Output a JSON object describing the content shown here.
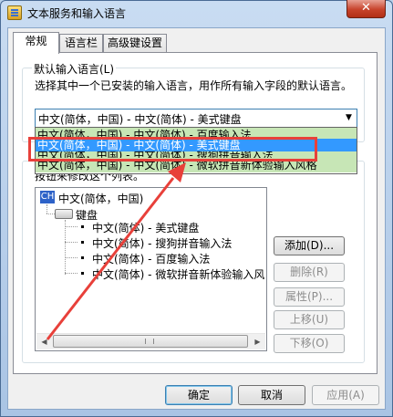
{
  "window": {
    "title": "文本服务和输入语言",
    "close_label": "✕"
  },
  "tabs": [
    {
      "label": "常规"
    },
    {
      "label": "语言栏"
    },
    {
      "label": "高级键设置"
    }
  ],
  "default_group": {
    "label": "默认输入语言(L)",
    "description": "选择其中一个已安装的输入语言，用作所有输入字段的默认语言。",
    "combo_value": "中文(简体，中国) - 中文(简体) - 美式键盘"
  },
  "dropdown_options": [
    {
      "label": "中文(简体，中国) - 中文(简体) - 百度输入法"
    },
    {
      "label": "中文(简体，中国) - 中文(简体) - 美式键盘"
    },
    {
      "label": "中文(简体，中国) - 中文(简体) - 搜狗拼音输入法"
    },
    {
      "label": "中文(简体，中国) - 中文(简体) - 微软拼音新体验输入风格"
    }
  ],
  "installed_group": {
    "label_partial": "按钮来修改这个列表。",
    "tree": {
      "language_badge": "CH",
      "language": "中文(简体，中国)",
      "category": "键盘",
      "items": [
        {
          "label": "中文(简体) - 美式键盘"
        },
        {
          "label": "中文(简体) - 搜狗拼音输入法"
        },
        {
          "label": "中文(简体) - 百度输入法"
        },
        {
          "label": "中文(简体) - 微软拼音新体验输入风"
        }
      ]
    }
  },
  "side_buttons": {
    "add": "添加(D)...",
    "remove": "删除(R)",
    "properties": "属性(P)...",
    "move_up": "上移(U)",
    "move_down": "下移(O)"
  },
  "bottom_buttons": {
    "ok": "确定",
    "cancel": "取消",
    "apply": "应用(A)"
  },
  "colors": {
    "annotation_red": "#e8403a",
    "selection_blue": "#3399ff",
    "option_highlight_green": "#c7e6b6"
  }
}
